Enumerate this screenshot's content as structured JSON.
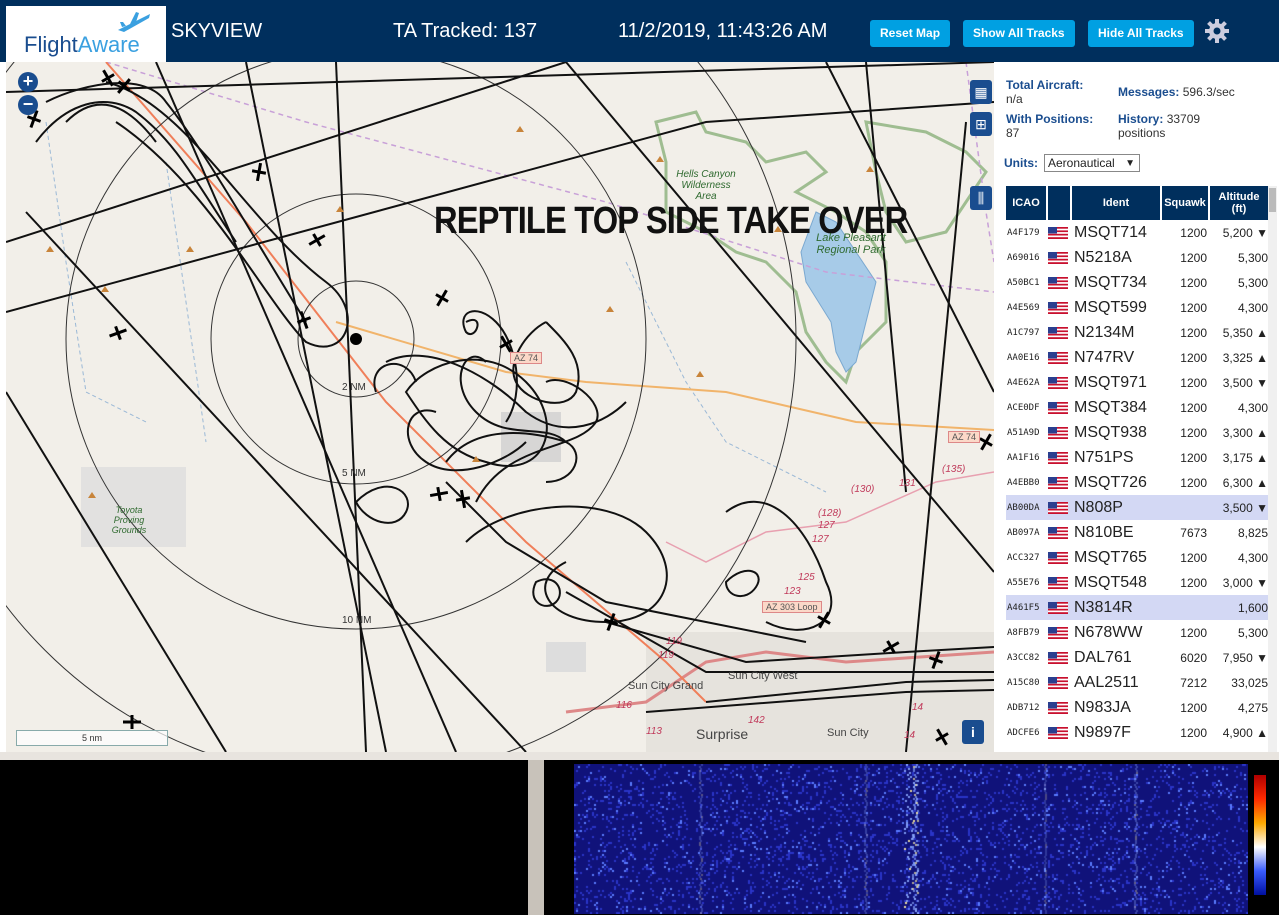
{
  "header": {
    "logo_text_1": "Flight",
    "logo_text_2": "Aware",
    "app_name": "SKYVIEW",
    "tracked_label": "TA Tracked: 137",
    "datetime": "11/2/2019, 11:43:26 AM",
    "buttons": [
      "Reset Map",
      "Show All Tracks",
      "Hide All Tracks"
    ],
    "settings_icon": "gear-icon"
  },
  "map": {
    "overlay_text": "REPTILE TOP SIDE TAKE OVER",
    "scale_label": "5 nm",
    "zoom_in": "+",
    "zoom_out": "−",
    "info_label": "i",
    "range_labels": [
      "2 NM",
      "5 NM",
      "10 NM"
    ],
    "place_labels": {
      "hells_canyon": "Hells Canyon Wilderness Area",
      "lake_pleasant": "Lake Pleasant Regional Park",
      "toyota": "Toyota Proving Grounds",
      "sun_city_grand": "Sun City Grand",
      "sun_city_west": "Sun City West",
      "surprise": "Surprise",
      "sun_city": "Sun City"
    },
    "road_labels": [
      "AZ 74",
      "AZ 74",
      "AZ 303 Loop",
      "(135)",
      "131",
      "(130)",
      "(128)",
      "127",
      "127",
      "125",
      "123",
      "119",
      "119",
      "116",
      "113",
      "142",
      "14",
      "14"
    ]
  },
  "sidebar": {
    "total_aircraft_label": "Total Aircraft:",
    "total_aircraft_value": "n/a",
    "messages_label": "Messages:",
    "messages_value": "596.3/sec",
    "with_positions_label": "With Positions:",
    "with_positions_value": "87",
    "history_label": "History:",
    "history_value": "33709",
    "history_unit": "positions",
    "units_label": "Units:",
    "units_value": "Aeronautical",
    "columns": [
      "ICAO",
      "",
      "Ident",
      "Squawk",
      "Altitude (ft)"
    ],
    "rows": [
      {
        "icao": "A4F179",
        "ident": "MSQT714",
        "squawk": "1200",
        "alt": "5,200 ▼"
      },
      {
        "icao": "A69016",
        "ident": "N5218A",
        "squawk": "1200",
        "alt": "5,300"
      },
      {
        "icao": "A50BC1",
        "ident": "MSQT734",
        "squawk": "1200",
        "alt": "5,300"
      },
      {
        "icao": "A4E569",
        "ident": "MSQT599",
        "squawk": "1200",
        "alt": "4,300"
      },
      {
        "icao": "A1C797",
        "ident": "N2134M",
        "squawk": "1200",
        "alt": "5,350 ▲"
      },
      {
        "icao": "AA0E16",
        "ident": "N747RV",
        "squawk": "1200",
        "alt": "3,325 ▲"
      },
      {
        "icao": "A4E62A",
        "ident": "MSQT971",
        "squawk": "1200",
        "alt": "3,500 ▼"
      },
      {
        "icao": "ACE0DF",
        "ident": "MSQT384",
        "squawk": "1200",
        "alt": "4,300"
      },
      {
        "icao": "A51A9D",
        "ident": "MSQT938",
        "squawk": "1200",
        "alt": "3,300 ▲"
      },
      {
        "icao": "AA1F16",
        "ident": "N751PS",
        "squawk": "1200",
        "alt": "3,175 ▲"
      },
      {
        "icao": "A4EBB0",
        "ident": "MSQT726",
        "squawk": "1200",
        "alt": "6,300 ▲"
      },
      {
        "icao": "AB00DA",
        "ident": "N808P",
        "squawk": "",
        "alt": "3,500 ▼",
        "selected": true
      },
      {
        "icao": "AB097A",
        "ident": "N810BE",
        "squawk": "7673",
        "alt": "8,825"
      },
      {
        "icao": "ACC327",
        "ident": "MSQT765",
        "squawk": "1200",
        "alt": "4,300"
      },
      {
        "icao": "A55E76",
        "ident": "MSQT548",
        "squawk": "1200",
        "alt": "3,000 ▼"
      },
      {
        "icao": "A461F5",
        "ident": "N3814R",
        "squawk": "",
        "alt": "1,600",
        "selected": true
      },
      {
        "icao": "A8FB79",
        "ident": "N678WW",
        "squawk": "1200",
        "alt": "5,300"
      },
      {
        "icao": "A3CC82",
        "ident": "DAL761",
        "squawk": "6020",
        "alt": "7,950 ▼"
      },
      {
        "icao": "A15C80",
        "ident": "AAL2511",
        "squawk": "7212",
        "alt": "33,025"
      },
      {
        "icao": "ADB712",
        "ident": "N983JA",
        "squawk": "1200",
        "alt": "4,275"
      },
      {
        "icao": "ADCFE6",
        "ident": "N9897F",
        "squawk": "1200",
        "alt": "4,900 ▲"
      }
    ]
  },
  "colors": {
    "header_bg": "#002f5d",
    "button_bg": "#00a0e2",
    "map_bg": "#f2efe9",
    "selected_row": "#d3d8f4"
  }
}
